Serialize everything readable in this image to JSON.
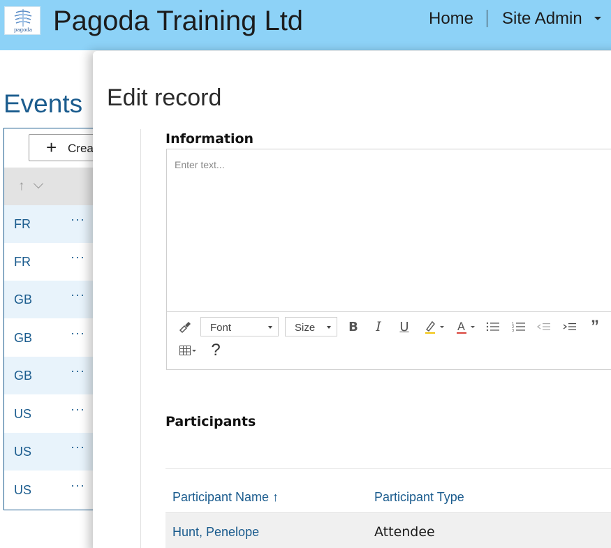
{
  "header": {
    "logo_text": "pagoda",
    "site_title": "Pagoda Training Ltd",
    "nav_home": "Home",
    "nav_site_admin": "Site Admin",
    "background_color": "#8dd2f7"
  },
  "events_list": {
    "title": "Events",
    "create_label": "Creat",
    "sort_icons": [
      "sort-ascending-icon",
      "chevron-down-icon"
    ],
    "rows": [
      {
        "code": "FR",
        "more": "···"
      },
      {
        "code": "FR",
        "more": "···"
      },
      {
        "code": "GB",
        "more": "···"
      },
      {
        "code": "GB",
        "more": "···"
      },
      {
        "code": "GB",
        "more": "···"
      },
      {
        "code": "US",
        "more": "···"
      },
      {
        "code": "US",
        "more": "···"
      },
      {
        "code": "US",
        "more": "···"
      }
    ]
  },
  "edit_panel": {
    "title": "Edit record",
    "information": {
      "label": "Information",
      "placeholder": "Enter text...",
      "toolbar": {
        "font_label": "Font",
        "size_label": "Size",
        "bold": "B",
        "italic": "I",
        "underline": "U",
        "quote": "”",
        "help": "?",
        "icons": [
          "paint-format-icon",
          "highlight-color-icon",
          "font-color-icon",
          "bullet-list-icon",
          "numbered-list-icon",
          "outdent-icon",
          "indent-icon",
          "quote-icon",
          "table-icon",
          "help-icon"
        ]
      }
    },
    "participants": {
      "label": "Participants",
      "columns": [
        "Participant Name",
        "Participant Type"
      ],
      "sort_indicator": "↑",
      "rows": [
        {
          "name": "Hunt, Penelope",
          "type": "Attendee"
        }
      ]
    }
  },
  "colors": {
    "link_blue": "#1b5c8e",
    "row_highlight": "#e8f3fb"
  }
}
